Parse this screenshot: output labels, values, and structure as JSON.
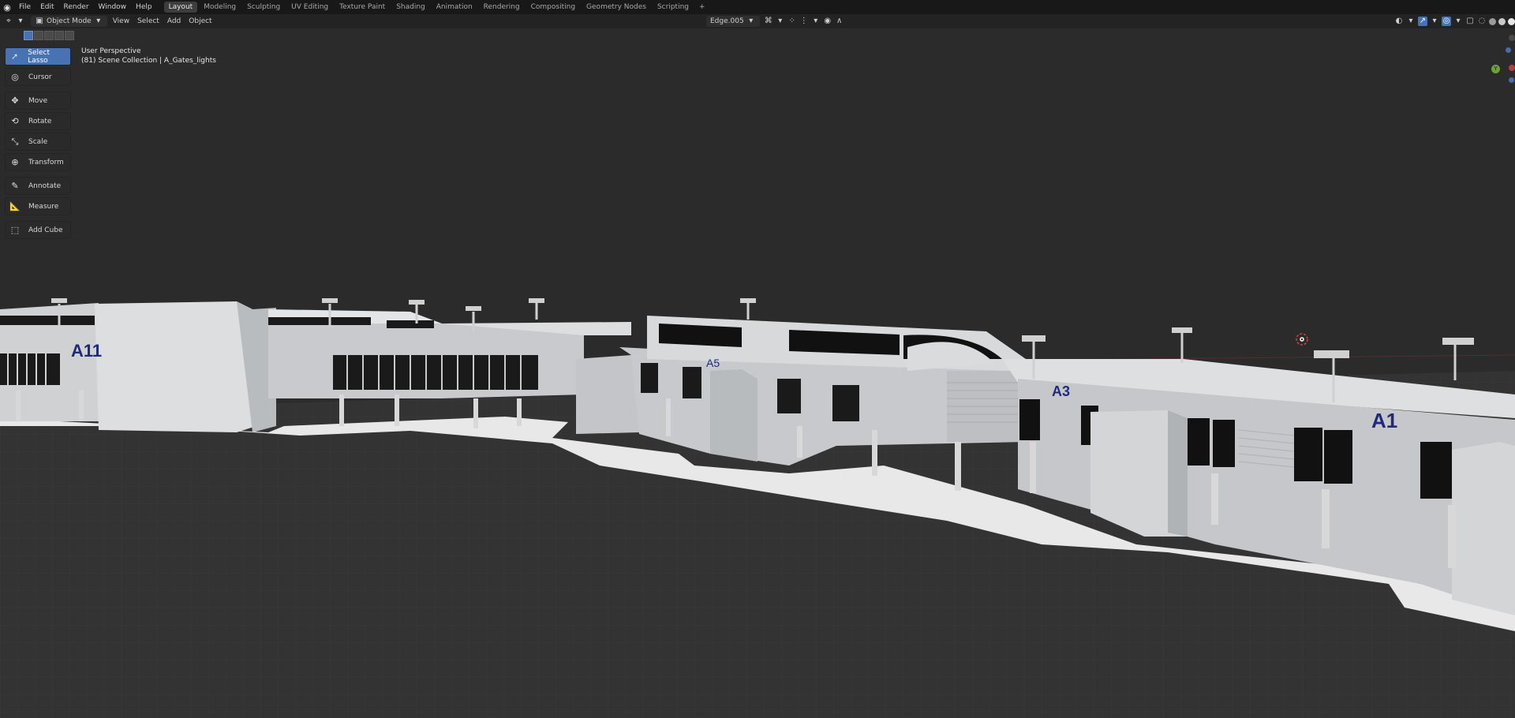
{
  "topbar": {
    "menus": [
      "File",
      "Edit",
      "Render",
      "Window",
      "Help"
    ],
    "workspaces": [
      "Layout",
      "Modeling",
      "Sculpting",
      "UV Editing",
      "Texture Paint",
      "Shading",
      "Animation",
      "Rendering",
      "Compositing",
      "Geometry Nodes",
      "Scripting"
    ],
    "active_workspace": "Layout",
    "add_tab": "+"
  },
  "header": {
    "mode": "Object Mode",
    "view": "View",
    "select": "Select",
    "add": "Add",
    "object": "Object",
    "active_object": "Edge.005"
  },
  "toolbar": {
    "tools": [
      {
        "label": "Select Lasso",
        "icon": "select-lasso-icon",
        "active": true
      },
      {
        "label": "Cursor",
        "icon": "cursor-icon"
      },
      {
        "label": "Move",
        "icon": "move-icon"
      },
      {
        "label": "Rotate",
        "icon": "rotate-icon"
      },
      {
        "label": "Scale",
        "icon": "scale-icon"
      },
      {
        "label": "Transform",
        "icon": "transform-icon"
      },
      {
        "label": "Annotate",
        "icon": "annotate-icon"
      },
      {
        "label": "Measure",
        "icon": "measure-icon"
      },
      {
        "label": "Add Cube",
        "icon": "add-cube-icon"
      }
    ]
  },
  "viewport": {
    "perspective": "User Perspective",
    "collection": "(81) Scene Collection | A_Gates_lights",
    "building_labels": [
      "A11",
      "A5",
      "A3",
      "A1"
    ]
  },
  "colors": {
    "accent": "#4772b3",
    "background": "#2b2b2b",
    "label_text": "#1f2a7a"
  }
}
